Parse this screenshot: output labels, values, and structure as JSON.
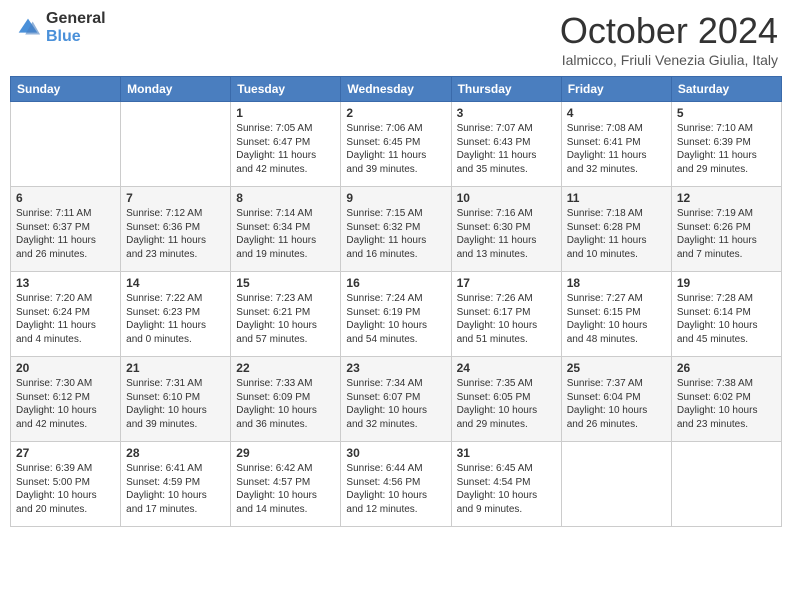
{
  "header": {
    "logo_general": "General",
    "logo_blue": "Blue",
    "month_title": "October 2024",
    "location": "Ialmicco, Friuli Venezia Giulia, Italy"
  },
  "days_of_week": [
    "Sunday",
    "Monday",
    "Tuesday",
    "Wednesday",
    "Thursday",
    "Friday",
    "Saturday"
  ],
  "weeks": [
    [
      {
        "day": "",
        "sunrise": "",
        "sunset": "",
        "daylight": ""
      },
      {
        "day": "",
        "sunrise": "",
        "sunset": "",
        "daylight": ""
      },
      {
        "day": "1",
        "sunrise": "Sunrise: 7:05 AM",
        "sunset": "Sunset: 6:47 PM",
        "daylight": "Daylight: 11 hours and 42 minutes."
      },
      {
        "day": "2",
        "sunrise": "Sunrise: 7:06 AM",
        "sunset": "Sunset: 6:45 PM",
        "daylight": "Daylight: 11 hours and 39 minutes."
      },
      {
        "day": "3",
        "sunrise": "Sunrise: 7:07 AM",
        "sunset": "Sunset: 6:43 PM",
        "daylight": "Daylight: 11 hours and 35 minutes."
      },
      {
        "day": "4",
        "sunrise": "Sunrise: 7:08 AM",
        "sunset": "Sunset: 6:41 PM",
        "daylight": "Daylight: 11 hours and 32 minutes."
      },
      {
        "day": "5",
        "sunrise": "Sunrise: 7:10 AM",
        "sunset": "Sunset: 6:39 PM",
        "daylight": "Daylight: 11 hours and 29 minutes."
      }
    ],
    [
      {
        "day": "6",
        "sunrise": "Sunrise: 7:11 AM",
        "sunset": "Sunset: 6:37 PM",
        "daylight": "Daylight: 11 hours and 26 minutes."
      },
      {
        "day": "7",
        "sunrise": "Sunrise: 7:12 AM",
        "sunset": "Sunset: 6:36 PM",
        "daylight": "Daylight: 11 hours and 23 minutes."
      },
      {
        "day": "8",
        "sunrise": "Sunrise: 7:14 AM",
        "sunset": "Sunset: 6:34 PM",
        "daylight": "Daylight: 11 hours and 19 minutes."
      },
      {
        "day": "9",
        "sunrise": "Sunrise: 7:15 AM",
        "sunset": "Sunset: 6:32 PM",
        "daylight": "Daylight: 11 hours and 16 minutes."
      },
      {
        "day": "10",
        "sunrise": "Sunrise: 7:16 AM",
        "sunset": "Sunset: 6:30 PM",
        "daylight": "Daylight: 11 hours and 13 minutes."
      },
      {
        "day": "11",
        "sunrise": "Sunrise: 7:18 AM",
        "sunset": "Sunset: 6:28 PM",
        "daylight": "Daylight: 11 hours and 10 minutes."
      },
      {
        "day": "12",
        "sunrise": "Sunrise: 7:19 AM",
        "sunset": "Sunset: 6:26 PM",
        "daylight": "Daylight: 11 hours and 7 minutes."
      }
    ],
    [
      {
        "day": "13",
        "sunrise": "Sunrise: 7:20 AM",
        "sunset": "Sunset: 6:24 PM",
        "daylight": "Daylight: 11 hours and 4 minutes."
      },
      {
        "day": "14",
        "sunrise": "Sunrise: 7:22 AM",
        "sunset": "Sunset: 6:23 PM",
        "daylight": "Daylight: 11 hours and 0 minutes."
      },
      {
        "day": "15",
        "sunrise": "Sunrise: 7:23 AM",
        "sunset": "Sunset: 6:21 PM",
        "daylight": "Daylight: 10 hours and 57 minutes."
      },
      {
        "day": "16",
        "sunrise": "Sunrise: 7:24 AM",
        "sunset": "Sunset: 6:19 PM",
        "daylight": "Daylight: 10 hours and 54 minutes."
      },
      {
        "day": "17",
        "sunrise": "Sunrise: 7:26 AM",
        "sunset": "Sunset: 6:17 PM",
        "daylight": "Daylight: 10 hours and 51 minutes."
      },
      {
        "day": "18",
        "sunrise": "Sunrise: 7:27 AM",
        "sunset": "Sunset: 6:15 PM",
        "daylight": "Daylight: 10 hours and 48 minutes."
      },
      {
        "day": "19",
        "sunrise": "Sunrise: 7:28 AM",
        "sunset": "Sunset: 6:14 PM",
        "daylight": "Daylight: 10 hours and 45 minutes."
      }
    ],
    [
      {
        "day": "20",
        "sunrise": "Sunrise: 7:30 AM",
        "sunset": "Sunset: 6:12 PM",
        "daylight": "Daylight: 10 hours and 42 minutes."
      },
      {
        "day": "21",
        "sunrise": "Sunrise: 7:31 AM",
        "sunset": "Sunset: 6:10 PM",
        "daylight": "Daylight: 10 hours and 39 minutes."
      },
      {
        "day": "22",
        "sunrise": "Sunrise: 7:33 AM",
        "sunset": "Sunset: 6:09 PM",
        "daylight": "Daylight: 10 hours and 36 minutes."
      },
      {
        "day": "23",
        "sunrise": "Sunrise: 7:34 AM",
        "sunset": "Sunset: 6:07 PM",
        "daylight": "Daylight: 10 hours and 32 minutes."
      },
      {
        "day": "24",
        "sunrise": "Sunrise: 7:35 AM",
        "sunset": "Sunset: 6:05 PM",
        "daylight": "Daylight: 10 hours and 29 minutes."
      },
      {
        "day": "25",
        "sunrise": "Sunrise: 7:37 AM",
        "sunset": "Sunset: 6:04 PM",
        "daylight": "Daylight: 10 hours and 26 minutes."
      },
      {
        "day": "26",
        "sunrise": "Sunrise: 7:38 AM",
        "sunset": "Sunset: 6:02 PM",
        "daylight": "Daylight: 10 hours and 23 minutes."
      }
    ],
    [
      {
        "day": "27",
        "sunrise": "Sunrise: 6:39 AM",
        "sunset": "Sunset: 5:00 PM",
        "daylight": "Daylight: 10 hours and 20 minutes."
      },
      {
        "day": "28",
        "sunrise": "Sunrise: 6:41 AM",
        "sunset": "Sunset: 4:59 PM",
        "daylight": "Daylight: 10 hours and 17 minutes."
      },
      {
        "day": "29",
        "sunrise": "Sunrise: 6:42 AM",
        "sunset": "Sunset: 4:57 PM",
        "daylight": "Daylight: 10 hours and 14 minutes."
      },
      {
        "day": "30",
        "sunrise": "Sunrise: 6:44 AM",
        "sunset": "Sunset: 4:56 PM",
        "daylight": "Daylight: 10 hours and 12 minutes."
      },
      {
        "day": "31",
        "sunrise": "Sunrise: 6:45 AM",
        "sunset": "Sunset: 4:54 PM",
        "daylight": "Daylight: 10 hours and 9 minutes."
      },
      {
        "day": "",
        "sunrise": "",
        "sunset": "",
        "daylight": ""
      },
      {
        "day": "",
        "sunrise": "",
        "sunset": "",
        "daylight": ""
      }
    ]
  ]
}
